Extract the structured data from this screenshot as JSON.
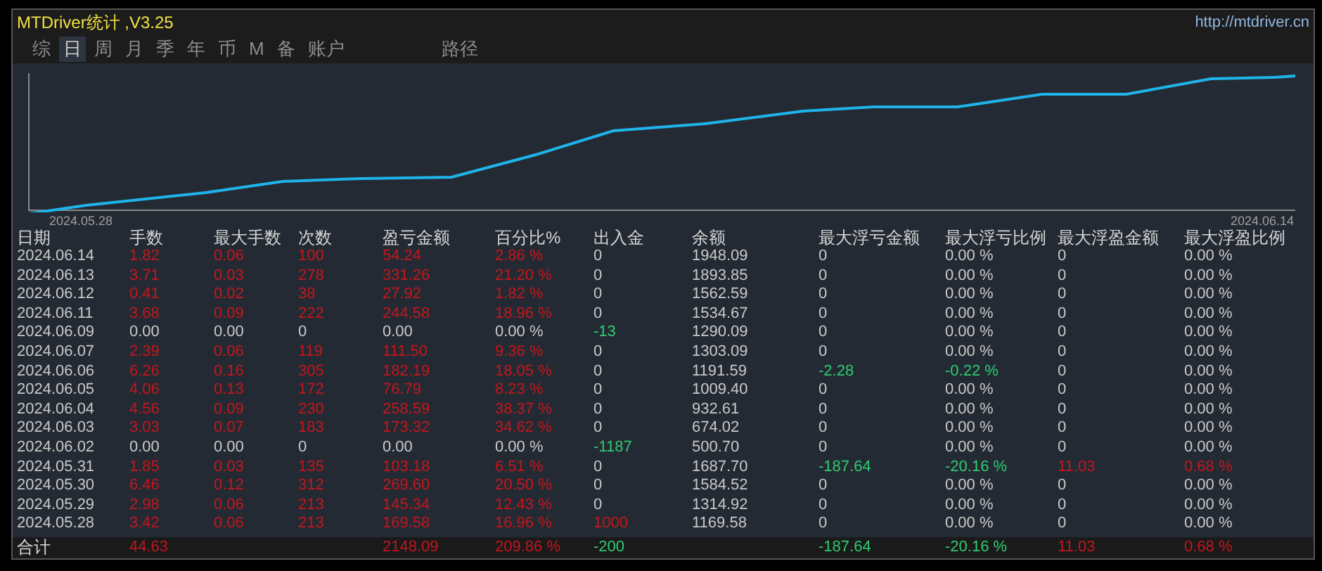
{
  "title": "MTDriver统计 ,V3.25",
  "url": "http://mtdriver.cn",
  "tabs": [
    {
      "label": "综",
      "selected": false
    },
    {
      "label": "日",
      "selected": true
    },
    {
      "label": "周",
      "selected": false
    },
    {
      "label": "月",
      "selected": false
    },
    {
      "label": "季",
      "selected": false
    },
    {
      "label": "年",
      "selected": false
    },
    {
      "label": "币",
      "selected": false
    },
    {
      "label": "M",
      "selected": false
    },
    {
      "label": "备",
      "selected": false
    },
    {
      "label": "账户",
      "selected": false
    },
    {
      "label": "路径",
      "selected": false
    }
  ],
  "chart": {
    "start_label": "2024.05.28",
    "end_label": "2024.06.14"
  },
  "table": {
    "columns": [
      "日期",
      "手数",
      "最大手数",
      "次数",
      "盈亏金额",
      "百分比%",
      "出入金",
      "余额",
      "最大浮亏金额",
      "最大浮亏比例",
      "最大浮盈金额",
      "最大浮盈比例"
    ],
    "rows": [
      {
        "cells": [
          {
            "text": "2024.06.14",
            "color": "#c8c8c8"
          },
          {
            "text": "1.82",
            "color": "#c4161c"
          },
          {
            "text": "0.06",
            "color": "#c4161c"
          },
          {
            "text": "100",
            "color": "#c4161c"
          },
          {
            "text": "54.24",
            "color": "#c4161c"
          },
          {
            "text": "2.86 %",
            "color": "#c4161c"
          },
          {
            "text": "0",
            "color": "#c8c8c8"
          },
          {
            "text": "1948.09",
            "color": "#c8c8c8"
          },
          {
            "text": "0",
            "color": "#c8c8c8"
          },
          {
            "text": "0.00 %",
            "color": "#c8c8c8"
          },
          {
            "text": "0",
            "color": "#c8c8c8"
          },
          {
            "text": "0.00 %",
            "color": "#c8c8c8"
          }
        ]
      },
      {
        "cells": [
          {
            "text": "2024.06.13",
            "color": "#c8c8c8"
          },
          {
            "text": "3.71",
            "color": "#c4161c"
          },
          {
            "text": "0.03",
            "color": "#c4161c"
          },
          {
            "text": "278",
            "color": "#c4161c"
          },
          {
            "text": "331.26",
            "color": "#c4161c"
          },
          {
            "text": "21.20 %",
            "color": "#c4161c"
          },
          {
            "text": "0",
            "color": "#c8c8c8"
          },
          {
            "text": "1893.85",
            "color": "#c8c8c8"
          },
          {
            "text": "0",
            "color": "#c8c8c8"
          },
          {
            "text": "0.00 %",
            "color": "#c8c8c8"
          },
          {
            "text": "0",
            "color": "#c8c8c8"
          },
          {
            "text": "0.00 %",
            "color": "#c8c8c8"
          }
        ]
      },
      {
        "cells": [
          {
            "text": "2024.06.12",
            "color": "#c8c8c8"
          },
          {
            "text": "0.41",
            "color": "#c4161c"
          },
          {
            "text": "0.02",
            "color": "#c4161c"
          },
          {
            "text": "38",
            "color": "#c4161c"
          },
          {
            "text": "27.92",
            "color": "#c4161c"
          },
          {
            "text": "1.82 %",
            "color": "#c4161c"
          },
          {
            "text": "0",
            "color": "#c8c8c8"
          },
          {
            "text": "1562.59",
            "color": "#c8c8c8"
          },
          {
            "text": "0",
            "color": "#c8c8c8"
          },
          {
            "text": "0.00 %",
            "color": "#c8c8c8"
          },
          {
            "text": "0",
            "color": "#c8c8c8"
          },
          {
            "text": "0.00 %",
            "color": "#c8c8c8"
          }
        ]
      },
      {
        "cells": [
          {
            "text": "2024.06.11",
            "color": "#c8c8c8"
          },
          {
            "text": "3.68",
            "color": "#c4161c"
          },
          {
            "text": "0.09",
            "color": "#c4161c"
          },
          {
            "text": "222",
            "color": "#c4161c"
          },
          {
            "text": "244.58",
            "color": "#c4161c"
          },
          {
            "text": "18.96 %",
            "color": "#c4161c"
          },
          {
            "text": "0",
            "color": "#c8c8c8"
          },
          {
            "text": "1534.67",
            "color": "#c8c8c8"
          },
          {
            "text": "0",
            "color": "#c8c8c8"
          },
          {
            "text": "0.00 %",
            "color": "#c8c8c8"
          },
          {
            "text": "0",
            "color": "#c8c8c8"
          },
          {
            "text": "0.00 %",
            "color": "#c8c8c8"
          }
        ]
      },
      {
        "cells": [
          {
            "text": "2024.06.09",
            "color": "#c8c8c8"
          },
          {
            "text": "0.00",
            "color": "#c8c8c8"
          },
          {
            "text": "0.00",
            "color": "#c8c8c8"
          },
          {
            "text": "0",
            "color": "#c8c8c8"
          },
          {
            "text": "0.00",
            "color": "#c8c8c8"
          },
          {
            "text": "0.00 %",
            "color": "#c8c8c8"
          },
          {
            "text": "-13",
            "color": "#2ecc71"
          },
          {
            "text": "1290.09",
            "color": "#c8c8c8"
          },
          {
            "text": "0",
            "color": "#c8c8c8"
          },
          {
            "text": "0.00 %",
            "color": "#c8c8c8"
          },
          {
            "text": "0",
            "color": "#c8c8c8"
          },
          {
            "text": "0.00 %",
            "color": "#c8c8c8"
          }
        ]
      },
      {
        "cells": [
          {
            "text": "2024.06.07",
            "color": "#c8c8c8"
          },
          {
            "text": "2.39",
            "color": "#c4161c"
          },
          {
            "text": "0.06",
            "color": "#c4161c"
          },
          {
            "text": "119",
            "color": "#c4161c"
          },
          {
            "text": "111.50",
            "color": "#c4161c"
          },
          {
            "text": "9.36 %",
            "color": "#c4161c"
          },
          {
            "text": "0",
            "color": "#c8c8c8"
          },
          {
            "text": "1303.09",
            "color": "#c8c8c8"
          },
          {
            "text": "0",
            "color": "#c8c8c8"
          },
          {
            "text": "0.00 %",
            "color": "#c8c8c8"
          },
          {
            "text": "0",
            "color": "#c8c8c8"
          },
          {
            "text": "0.00 %",
            "color": "#c8c8c8"
          }
        ]
      },
      {
        "cells": [
          {
            "text": "2024.06.06",
            "color": "#c8c8c8"
          },
          {
            "text": "6.26",
            "color": "#c4161c"
          },
          {
            "text": "0.16",
            "color": "#c4161c"
          },
          {
            "text": "305",
            "color": "#c4161c"
          },
          {
            "text": "182.19",
            "color": "#c4161c"
          },
          {
            "text": "18.05 %",
            "color": "#c4161c"
          },
          {
            "text": "0",
            "color": "#c8c8c8"
          },
          {
            "text": "1191.59",
            "color": "#c8c8c8"
          },
          {
            "text": "-2.28",
            "color": "#2ecc71"
          },
          {
            "text": "-0.22 %",
            "color": "#2ecc71"
          },
          {
            "text": "0",
            "color": "#c8c8c8"
          },
          {
            "text": "0.00 %",
            "color": "#c8c8c8"
          }
        ]
      },
      {
        "cells": [
          {
            "text": "2024.06.05",
            "color": "#c8c8c8"
          },
          {
            "text": "4.06",
            "color": "#c4161c"
          },
          {
            "text": "0.13",
            "color": "#c4161c"
          },
          {
            "text": "172",
            "color": "#c4161c"
          },
          {
            "text": "76.79",
            "color": "#c4161c"
          },
          {
            "text": "8.23 %",
            "color": "#c4161c"
          },
          {
            "text": "0",
            "color": "#c8c8c8"
          },
          {
            "text": "1009.40",
            "color": "#c8c8c8"
          },
          {
            "text": "0",
            "color": "#c8c8c8"
          },
          {
            "text": "0.00 %",
            "color": "#c8c8c8"
          },
          {
            "text": "0",
            "color": "#c8c8c8"
          },
          {
            "text": "0.00 %",
            "color": "#c8c8c8"
          }
        ]
      },
      {
        "cells": [
          {
            "text": "2024.06.04",
            "color": "#c8c8c8"
          },
          {
            "text": "4.56",
            "color": "#c4161c"
          },
          {
            "text": "0.09",
            "color": "#c4161c"
          },
          {
            "text": "230",
            "color": "#c4161c"
          },
          {
            "text": "258.59",
            "color": "#c4161c"
          },
          {
            "text": "38.37 %",
            "color": "#c4161c"
          },
          {
            "text": "0",
            "color": "#c8c8c8"
          },
          {
            "text": "932.61",
            "color": "#c8c8c8"
          },
          {
            "text": "0",
            "color": "#c8c8c8"
          },
          {
            "text": "0.00 %",
            "color": "#c8c8c8"
          },
          {
            "text": "0",
            "color": "#c8c8c8"
          },
          {
            "text": "0.00 %",
            "color": "#c8c8c8"
          }
        ]
      },
      {
        "cells": [
          {
            "text": "2024.06.03",
            "color": "#c8c8c8"
          },
          {
            "text": "3.03",
            "color": "#c4161c"
          },
          {
            "text": "0.07",
            "color": "#c4161c"
          },
          {
            "text": "183",
            "color": "#c4161c"
          },
          {
            "text": "173.32",
            "color": "#c4161c"
          },
          {
            "text": "34.62 %",
            "color": "#c4161c"
          },
          {
            "text": "0",
            "color": "#c8c8c8"
          },
          {
            "text": "674.02",
            "color": "#c8c8c8"
          },
          {
            "text": "0",
            "color": "#c8c8c8"
          },
          {
            "text": "0.00 %",
            "color": "#c8c8c8"
          },
          {
            "text": "0",
            "color": "#c8c8c8"
          },
          {
            "text": "0.00 %",
            "color": "#c8c8c8"
          }
        ]
      },
      {
        "cells": [
          {
            "text": "2024.06.02",
            "color": "#c8c8c8"
          },
          {
            "text": "0.00",
            "color": "#c8c8c8"
          },
          {
            "text": "0.00",
            "color": "#c8c8c8"
          },
          {
            "text": "0",
            "color": "#c8c8c8"
          },
          {
            "text": "0.00",
            "color": "#c8c8c8"
          },
          {
            "text": "0.00 %",
            "color": "#c8c8c8"
          },
          {
            "text": "-1187",
            "color": "#2ecc71"
          },
          {
            "text": "500.70",
            "color": "#c8c8c8"
          },
          {
            "text": "0",
            "color": "#c8c8c8"
          },
          {
            "text": "0.00 %",
            "color": "#c8c8c8"
          },
          {
            "text": "0",
            "color": "#c8c8c8"
          },
          {
            "text": "0.00 %",
            "color": "#c8c8c8"
          }
        ]
      },
      {
        "cells": [
          {
            "text": "2024.05.31",
            "color": "#c8c8c8"
          },
          {
            "text": "1.85",
            "color": "#c4161c"
          },
          {
            "text": "0.03",
            "color": "#c4161c"
          },
          {
            "text": "135",
            "color": "#c4161c"
          },
          {
            "text": "103.18",
            "color": "#c4161c"
          },
          {
            "text": "6.51 %",
            "color": "#c4161c"
          },
          {
            "text": "0",
            "color": "#c8c8c8"
          },
          {
            "text": "1687.70",
            "color": "#c8c8c8"
          },
          {
            "text": "-187.64",
            "color": "#2ecc71"
          },
          {
            "text": "-20.16 %",
            "color": "#2ecc71"
          },
          {
            "text": "11.03",
            "color": "#c4161c"
          },
          {
            "text": "0.68 %",
            "color": "#c4161c"
          }
        ]
      },
      {
        "cells": [
          {
            "text": "2024.05.30",
            "color": "#c8c8c8"
          },
          {
            "text": "6.46",
            "color": "#c4161c"
          },
          {
            "text": "0.12",
            "color": "#c4161c"
          },
          {
            "text": "312",
            "color": "#c4161c"
          },
          {
            "text": "269.60",
            "color": "#c4161c"
          },
          {
            "text": "20.50 %",
            "color": "#c4161c"
          },
          {
            "text": "0",
            "color": "#c8c8c8"
          },
          {
            "text": "1584.52",
            "color": "#c8c8c8"
          },
          {
            "text": "0",
            "color": "#c8c8c8"
          },
          {
            "text": "0.00 %",
            "color": "#c8c8c8"
          },
          {
            "text": "0",
            "color": "#c8c8c8"
          },
          {
            "text": "0.00 %",
            "color": "#c8c8c8"
          }
        ]
      },
      {
        "cells": [
          {
            "text": "2024.05.29",
            "color": "#c8c8c8"
          },
          {
            "text": "2.98",
            "color": "#c4161c"
          },
          {
            "text": "0.06",
            "color": "#c4161c"
          },
          {
            "text": "213",
            "color": "#c4161c"
          },
          {
            "text": "145.34",
            "color": "#c4161c"
          },
          {
            "text": "12.43 %",
            "color": "#c4161c"
          },
          {
            "text": "0",
            "color": "#c8c8c8"
          },
          {
            "text": "1314.92",
            "color": "#c8c8c8"
          },
          {
            "text": "0",
            "color": "#c8c8c8"
          },
          {
            "text": "0.00 %",
            "color": "#c8c8c8"
          },
          {
            "text": "0",
            "color": "#c8c8c8"
          },
          {
            "text": "0.00 %",
            "color": "#c8c8c8"
          }
        ]
      },
      {
        "cells": [
          {
            "text": "2024.05.28",
            "color": "#c8c8c8"
          },
          {
            "text": "3.42",
            "color": "#c4161c"
          },
          {
            "text": "0.06",
            "color": "#c4161c"
          },
          {
            "text": "213",
            "color": "#c4161c"
          },
          {
            "text": "169.58",
            "color": "#c4161c"
          },
          {
            "text": "16.96 %",
            "color": "#c4161c"
          },
          {
            "text": "1000",
            "color": "#c4161c"
          },
          {
            "text": "1169.58",
            "color": "#c8c8c8"
          },
          {
            "text": "0",
            "color": "#c8c8c8"
          },
          {
            "text": "0.00 %",
            "color": "#c8c8c8"
          },
          {
            "text": "0",
            "color": "#c8c8c8"
          },
          {
            "text": "0.00 %",
            "color": "#c8c8c8"
          }
        ]
      }
    ],
    "total": {
      "cells": [
        {
          "text": "合计",
          "color": "#d6d6d6"
        },
        {
          "text": "44.63",
          "color": "#c4161c"
        },
        null,
        null,
        {
          "text": "2148.09",
          "color": "#c4161c"
        },
        {
          "text": "209.86 %",
          "color": "#c4161c"
        },
        {
          "text": "-200",
          "color": "#2ecc71"
        },
        null,
        {
          "text": "-187.64",
          "color": "#2ecc71"
        },
        {
          "text": "-20.16 %",
          "color": "#2ecc71"
        },
        {
          "text": "11.03",
          "color": "#c4161c"
        },
        {
          "text": "0.68 %",
          "color": "#c4161c"
        }
      ]
    }
  }
}
